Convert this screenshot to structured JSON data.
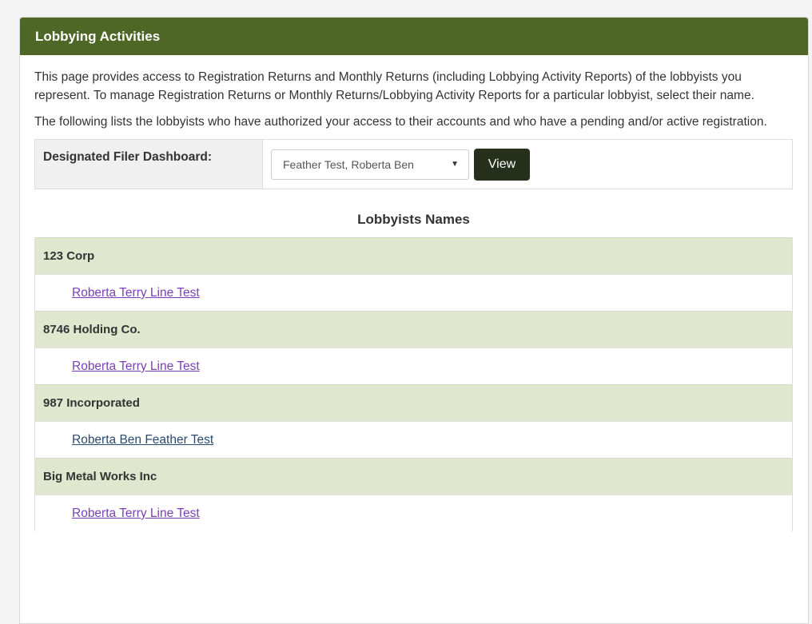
{
  "panel": {
    "title": "Lobbying Activities"
  },
  "intro": {
    "paragraph1": "This page provides access to Registration Returns and Monthly Returns (including Lobbying Activity Reports) of the lobbyists you represent. To manage Registration Returns or Monthly Returns/Lobbying Activity Reports for a particular lobbyist, select their name.",
    "paragraph2": "The following lists the lobbyists who have authorized your access to their accounts and who have a pending and/or active registration."
  },
  "filer": {
    "label": "Designated Filer Dashboard:",
    "selected": "Feather Test, Roberta Ben",
    "view_label": "View"
  },
  "list": {
    "heading": "Lobbyists Names",
    "groups": [
      {
        "org": "123 Corp",
        "person": "Roberta Terry Line Test"
      },
      {
        "org": "8746 Holding Co.",
        "person": "Roberta Terry Line Test"
      },
      {
        "org": "987 Incorporated",
        "person": "Roberta Ben Feather Test"
      },
      {
        "org": "Big Metal Works Inc",
        "person": "Roberta Terry Line Test"
      }
    ]
  },
  "colors": {
    "header_bg": "#4e6626",
    "org_row_bg": "#dfe8cf",
    "button_bg": "#26301a",
    "visited_link": "#7a3fb8",
    "link": "#2a4a6e"
  }
}
